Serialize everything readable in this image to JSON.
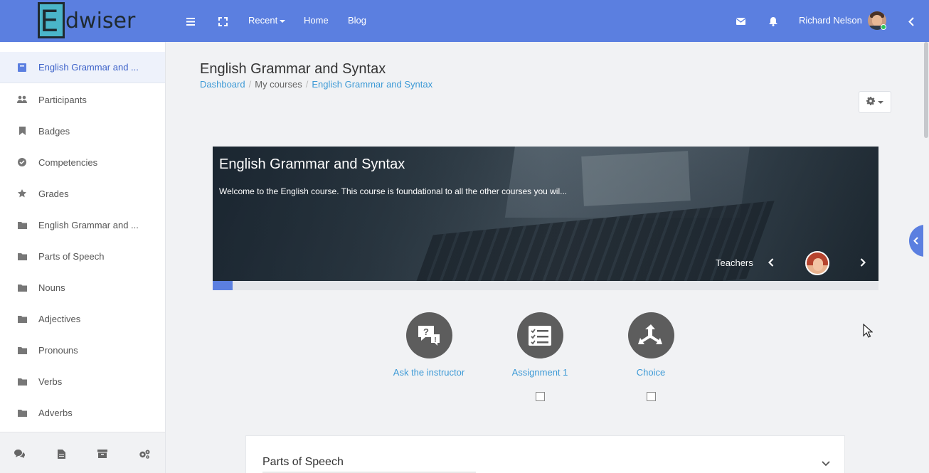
{
  "brand": {
    "initial": "E",
    "rest": "dwiser"
  },
  "navbar": {
    "recent_label": "Recent",
    "home_label": "Home",
    "blog_label": "Blog",
    "user_name": "Richard Nelson",
    "accent_color": "#5b7fe0"
  },
  "drawer": {
    "items": [
      {
        "label": "English Grammar and ...",
        "icon": "course-icon",
        "active": true
      },
      {
        "label": "Participants",
        "icon": "users-icon"
      },
      {
        "label": "Badges",
        "icon": "bookmark-icon"
      },
      {
        "label": "Competencies",
        "icon": "check-circle-icon"
      },
      {
        "label": "Grades",
        "icon": "star-icon"
      },
      {
        "label": "English Grammar and ...",
        "icon": "folder-icon"
      },
      {
        "label": "Parts of Speech",
        "icon": "folder-icon"
      },
      {
        "label": "Nouns",
        "icon": "folder-icon"
      },
      {
        "label": "Adjectives",
        "icon": "folder-icon"
      },
      {
        "label": "Pronouns",
        "icon": "folder-icon"
      },
      {
        "label": "Verbs",
        "icon": "folder-icon"
      },
      {
        "label": "Adverbs",
        "icon": "folder-icon"
      }
    ],
    "footer_icons": [
      "comments-icon",
      "file-icon",
      "archive-icon",
      "cogs-icon"
    ]
  },
  "page": {
    "title": "English Grammar and Syntax",
    "breadcrumb": [
      "Dashboard",
      "My courses",
      "English Grammar and Syntax"
    ]
  },
  "hero": {
    "title": "English Grammar and Syntax",
    "summary": "Welcome to the English course.  This course is foundational to all the other courses you wil...",
    "teachers_label": "Teachers",
    "progress_percent": 3
  },
  "activities": [
    {
      "label": "Ask the instructor",
      "icon": "question-bubble-icon",
      "has_checkbox": false
    },
    {
      "label": "Assignment 1",
      "icon": "checklist-icon",
      "has_checkbox": true,
      "checked": false
    },
    {
      "label": "Choice",
      "icon": "choice-arrows-icon",
      "has_checkbox": true,
      "checked": false
    }
  ],
  "section": {
    "title": "Parts of Speech"
  }
}
